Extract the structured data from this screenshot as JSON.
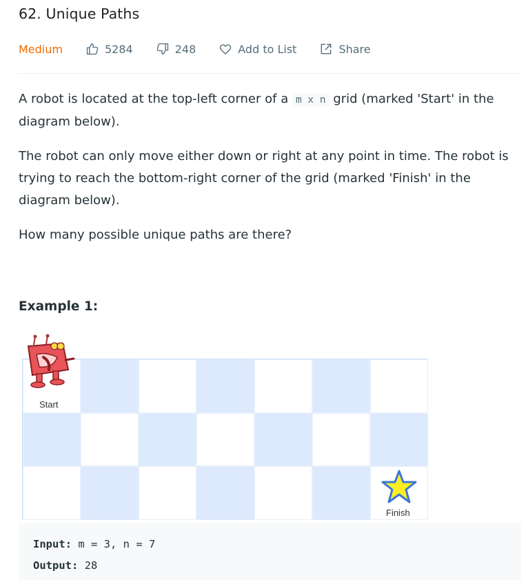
{
  "problem": {
    "title": "62. Unique Paths",
    "difficulty": "Medium",
    "likes": "5284",
    "dislikes": "248",
    "add_to_list_label": "Add to List",
    "share_label": "Share"
  },
  "description": {
    "p1_before": "A robot is located at the top-left corner of a ",
    "p1_code": "m x n",
    "p1_after": " grid (marked 'Start' in the diagram below).",
    "p2": "The robot can only move either down or right at any point in time. The robot is trying to reach the bottom-right corner of the grid (marked 'Finish' in the diagram below).",
    "p3": "How many possible unique paths are there?"
  },
  "example": {
    "title": "Example 1:",
    "start_label": "Start",
    "finish_label": "Finish",
    "input_label": "Input:",
    "input_value": "m = 3, n = 7",
    "output_label": "Output:",
    "output_value": "28"
  },
  "colors": {
    "difficulty_medium": "#ef6c00",
    "grid_blue": "#dde9fc",
    "star_fill": "#ffee22",
    "star_stroke": "#3a78d8"
  },
  "icons": [
    "thumbs-up-icon",
    "thumbs-down-icon",
    "heart-icon",
    "share-icon",
    "robot-icon",
    "star-icon"
  ]
}
